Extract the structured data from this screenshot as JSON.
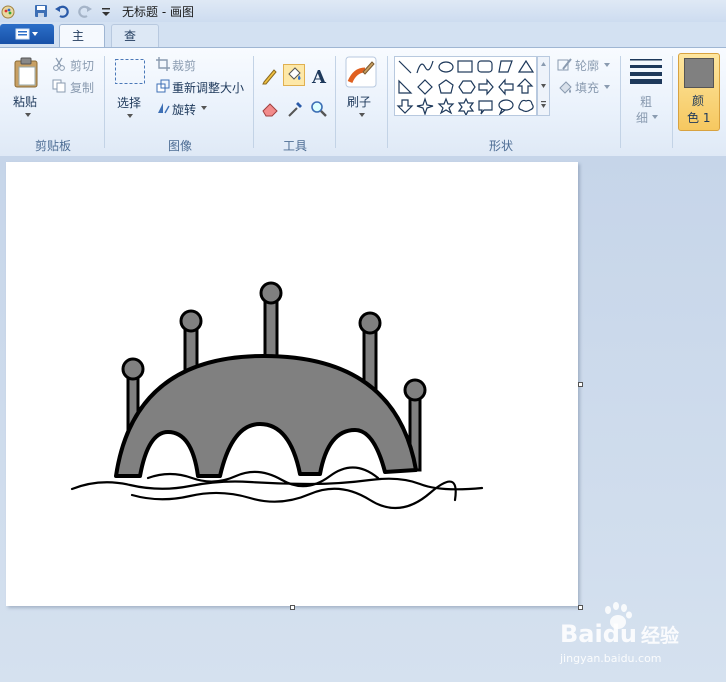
{
  "window": {
    "title": "无标题 - 画图"
  },
  "tabs": [
    {
      "label": "主页"
    },
    {
      "label": "查看"
    }
  ],
  "clipboard": {
    "paste": "粘贴",
    "cut": "剪切",
    "copy": "复制",
    "group": "剪贴板"
  },
  "image": {
    "select": "选择",
    "crop": "裁剪",
    "resize": "重新调整大小",
    "rotate": "旋转",
    "group": "图像"
  },
  "tools": {
    "group": "工具"
  },
  "brush": {
    "label": "刷子"
  },
  "shapes": {
    "outline": "轮廓",
    "fill": "填充",
    "group": "形状"
  },
  "size": {
    "label1": "粗",
    "label2": "细"
  },
  "color1": {
    "label1": "颜",
    "label2": "色 1",
    "value": "#808080"
  },
  "watermark": {
    "brand_a": "Bai",
    "brand_b": "du",
    "brand_c": "经验",
    "url": "jingyan.baidu.com"
  }
}
